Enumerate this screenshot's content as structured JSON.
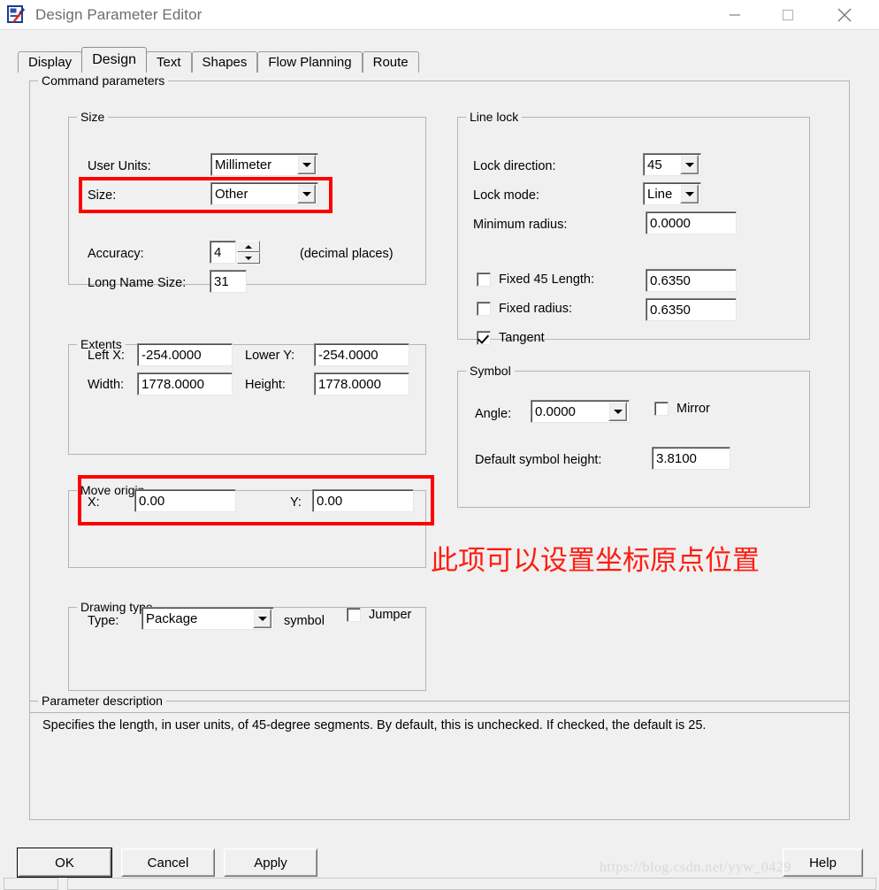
{
  "window": {
    "title": "Design Parameter Editor",
    "icon": "app-icon",
    "minimize_label": "—",
    "maximize_label": "□",
    "close_label": "✕"
  },
  "tabs": [
    {
      "label": "Display",
      "selected": false
    },
    {
      "label": "Design",
      "selected": true
    },
    {
      "label": "Text",
      "selected": false
    },
    {
      "label": "Shapes",
      "selected": false
    },
    {
      "label": "Flow Planning",
      "selected": false
    },
    {
      "label": "Route",
      "selected": false
    }
  ],
  "command_parameters": {
    "title": "Command parameters",
    "size": {
      "title": "Size",
      "user_units_label": "User Units:",
      "user_units_value": "Millimeter",
      "size_label": "Size:",
      "size_value": "Other",
      "accuracy_label": "Accuracy:",
      "accuracy_value": "4",
      "accuracy_hint": "(decimal places)",
      "long_name_size_label": "Long Name Size:",
      "long_name_size_value": "31"
    },
    "extents": {
      "title": "Extents",
      "left_x_label": "Left X:",
      "left_x_value": "-254.0000",
      "lower_y_label": "Lower Y:",
      "lower_y_value": "-254.0000",
      "width_label": "Width:",
      "width_value": "1778.0000",
      "height_label": "Height:",
      "height_value": "1778.0000"
    },
    "move_origin": {
      "title": "Move origin",
      "x_label": "X:",
      "x_value": "0.00",
      "y_label": "Y:",
      "y_value": "0.00"
    },
    "drawing_type": {
      "title": "Drawing type",
      "type_label": "Type:",
      "type_value": "Package",
      "symbol_label": "symbol",
      "jumper_label": "Jumper",
      "jumper_checked": false
    },
    "line_lock": {
      "title": "Line lock",
      "lock_direction_label": "Lock direction:",
      "lock_direction_value": "45",
      "lock_mode_label": "Lock mode:",
      "lock_mode_value": "Line",
      "minimum_radius_label": "Minimum radius:",
      "minimum_radius_value": "0.0000",
      "fixed_45_length_label": "Fixed 45 Length:",
      "fixed_45_length_value": "0.6350",
      "fixed_45_length_checked": false,
      "fixed_radius_label": "Fixed radius:",
      "fixed_radius_value": "0.6350",
      "fixed_radius_checked": false,
      "tangent_label": "Tangent",
      "tangent_checked": true
    },
    "symbol": {
      "title": "Symbol",
      "angle_label": "Angle:",
      "angle_value": "0.0000",
      "mirror_label": "Mirror",
      "mirror_checked": false,
      "default_symbol_height_label": "Default symbol height:",
      "default_symbol_height_value": "3.8100"
    }
  },
  "parameter_description": {
    "title": "Parameter description",
    "text": "Specifies the length, in user units, of 45-degree segments. By default, this is unchecked. If checked, the default is 25."
  },
  "buttons": {
    "ok": "OK",
    "cancel": "Cancel",
    "apply": "Apply",
    "help": "Help"
  },
  "annotations": {
    "chinese_note": "此项可以设置坐标原点位置",
    "highlight_color": "#ff0000"
  },
  "watermark": "https://blog.csdn.net/yyw_0429"
}
